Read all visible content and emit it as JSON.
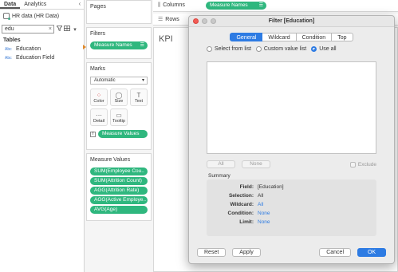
{
  "data_pane": {
    "tabs": [
      "Data",
      "Analytics"
    ],
    "collapse": "‹",
    "datasource": "HR data (HR Data)",
    "search_value": "edu",
    "search_clear": "×",
    "tables_label": "Tables",
    "fields": [
      {
        "type": "Abc",
        "name": "Education"
      },
      {
        "type": "Abc",
        "name": "Education Field"
      }
    ]
  },
  "shelves": {
    "pages": "Pages",
    "filters": "Filters",
    "filter_pill": "Measure Names",
    "marks": "Marks",
    "mark_type": "Automatic",
    "mark_buttons": [
      {
        "icon": "⁘",
        "label": "Color"
      },
      {
        "icon": "◯",
        "label": "Size"
      },
      {
        "icon": "T",
        "label": "Text"
      },
      {
        "icon": "⋯",
        "label": "Detail"
      },
      {
        "icon": "▭",
        "label": "Tooltip"
      }
    ],
    "marks_pill": "Measure Values",
    "measure_values_title": "Measure Values",
    "measure_values": [
      "SUM(Employee Cou..",
      "SUM(Attrition Count)",
      "AGG(Attrition Rate)",
      "AGG(Active Employe..",
      "AVG(Age)"
    ]
  },
  "canvas": {
    "columns_label": "Columns",
    "columns_pill": "Measure Names",
    "rows_label": "Rows",
    "sheet_title": "KPI"
  },
  "dialog": {
    "title": "Filter [Education]",
    "tabs": [
      "General",
      "Wildcard",
      "Condition",
      "Top"
    ],
    "radio_options": [
      "Select from list",
      "Custom value list",
      "Use all"
    ],
    "all_button": "All",
    "none_button": "None",
    "exclude_label": "Exclude",
    "summary_label": "Summary",
    "summary": [
      {
        "key": "Field:",
        "value": "[Education]"
      },
      {
        "key": "Selection:",
        "value": "All"
      },
      {
        "key": "Wildcard:",
        "value": "All"
      },
      {
        "key": "Condition:",
        "value": "None"
      },
      {
        "key": "Limit:",
        "value": "None"
      }
    ],
    "reset": "Reset",
    "apply": "Apply",
    "cancel": "Cancel",
    "ok": "OK"
  },
  "colors": {
    "pill_green": "#2fb77e",
    "accent_blue": "#2d7be3",
    "close_red": "#f35b55"
  }
}
